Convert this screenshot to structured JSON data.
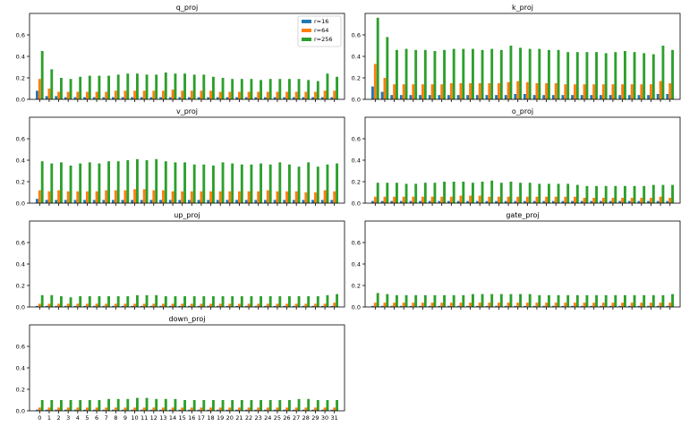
{
  "chart_data": {
    "type": "bar",
    "series_names": [
      "r=16",
      "r=64",
      "r=256"
    ],
    "colors": [
      "#1f77b4",
      "#ff7f0e",
      "#2ca02c"
    ],
    "x": [
      0,
      1,
      2,
      3,
      4,
      5,
      6,
      7,
      8,
      9,
      10,
      11,
      12,
      13,
      14,
      15,
      16,
      17,
      18,
      19,
      20,
      21,
      22,
      23,
      24,
      25,
      26,
      27,
      28,
      29,
      30,
      31
    ],
    "ylim": [
      0,
      0.8
    ],
    "yticks": [
      "0.0",
      "0.2",
      "0.4",
      "0.6"
    ],
    "legend_location": "top-right of first panel",
    "panels": [
      {
        "title": "q_proj",
        "series": [
          {
            "name": "r=16",
            "values": [
              0.08,
              0.03,
              0.03,
              0.02,
              0.02,
              0.02,
              0.02,
              0.02,
              0.02,
              0.02,
              0.02,
              0.02,
              0.02,
              0.02,
              0.02,
              0.02,
              0.02,
              0.02,
              0.02,
              0.02,
              0.02,
              0.02,
              0.02,
              0.02,
              0.02,
              0.02,
              0.02,
              0.02,
              0.02,
              0.02,
              0.02,
              0.02
            ]
          },
          {
            "name": "r=64",
            "values": [
              0.19,
              0.1,
              0.07,
              0.07,
              0.07,
              0.07,
              0.07,
              0.07,
              0.08,
              0.08,
              0.08,
              0.08,
              0.08,
              0.08,
              0.09,
              0.08,
              0.08,
              0.08,
              0.08,
              0.07,
              0.07,
              0.07,
              0.07,
              0.07,
              0.07,
              0.07,
              0.07,
              0.07,
              0.07,
              0.07,
              0.08,
              0.08
            ]
          },
          {
            "name": "r=256",
            "values": [
              0.45,
              0.28,
              0.2,
              0.19,
              0.21,
              0.22,
              0.22,
              0.22,
              0.23,
              0.24,
              0.24,
              0.23,
              0.23,
              0.25,
              0.24,
              0.24,
              0.23,
              0.23,
              0.21,
              0.2,
              0.19,
              0.19,
              0.19,
              0.18,
              0.19,
              0.19,
              0.19,
              0.19,
              0.18,
              0.17,
              0.24,
              0.21
            ]
          }
        ]
      },
      {
        "title": "k_proj",
        "series": [
          {
            "name": "r=16",
            "values": [
              0.12,
              0.07,
              0.04,
              0.04,
              0.04,
              0.04,
              0.04,
              0.04,
              0.04,
              0.04,
              0.04,
              0.04,
              0.04,
              0.04,
              0.04,
              0.05,
              0.05,
              0.04,
              0.04,
              0.04,
              0.04,
              0.04,
              0.04,
              0.04,
              0.04,
              0.04,
              0.04,
              0.04,
              0.04,
              0.04,
              0.05,
              0.05
            ]
          },
          {
            "name": "r=64",
            "values": [
              0.33,
              0.2,
              0.14,
              0.14,
              0.14,
              0.14,
              0.14,
              0.14,
              0.15,
              0.15,
              0.15,
              0.15,
              0.15,
              0.15,
              0.16,
              0.17,
              0.16,
              0.15,
              0.15,
              0.15,
              0.14,
              0.14,
              0.14,
              0.14,
              0.14,
              0.14,
              0.14,
              0.14,
              0.14,
              0.14,
              0.17,
              0.15
            ]
          },
          {
            "name": "r=256",
            "values": [
              0.76,
              0.58,
              0.46,
              0.47,
              0.46,
              0.46,
              0.45,
              0.46,
              0.47,
              0.47,
              0.47,
              0.46,
              0.47,
              0.46,
              0.5,
              0.48,
              0.47,
              0.47,
              0.46,
              0.46,
              0.44,
              0.44,
              0.44,
              0.44,
              0.43,
              0.44,
              0.45,
              0.44,
              0.43,
              0.42,
              0.5,
              0.46
            ]
          }
        ]
      },
      {
        "title": "v_proj",
        "series": [
          {
            "name": "r=16",
            "values": [
              0.04,
              0.03,
              0.03,
              0.03,
              0.03,
              0.03,
              0.03,
              0.03,
              0.03,
              0.03,
              0.03,
              0.03,
              0.03,
              0.03,
              0.03,
              0.03,
              0.03,
              0.03,
              0.03,
              0.03,
              0.03,
              0.03,
              0.03,
              0.03,
              0.03,
              0.03,
              0.03,
              0.03,
              0.03,
              0.03,
              0.03,
              0.03
            ]
          },
          {
            "name": "r=64",
            "values": [
              0.12,
              0.11,
              0.12,
              0.11,
              0.11,
              0.11,
              0.11,
              0.12,
              0.12,
              0.12,
              0.13,
              0.13,
              0.12,
              0.12,
              0.11,
              0.11,
              0.11,
              0.11,
              0.11,
              0.11,
              0.11,
              0.11,
              0.11,
              0.11,
              0.12,
              0.11,
              0.11,
              0.11,
              0.1,
              0.1,
              0.12,
              0.11
            ]
          },
          {
            "name": "r=256",
            "values": [
              0.39,
              0.37,
              0.38,
              0.35,
              0.37,
              0.38,
              0.37,
              0.39,
              0.39,
              0.4,
              0.41,
              0.4,
              0.41,
              0.39,
              0.38,
              0.38,
              0.36,
              0.36,
              0.35,
              0.38,
              0.37,
              0.36,
              0.36,
              0.37,
              0.36,
              0.38,
              0.36,
              0.34,
              0.38,
              0.34,
              0.36,
              0.37
            ]
          }
        ]
      },
      {
        "title": "o_proj",
        "series": [
          {
            "name": "r=16",
            "values": [
              0.02,
              0.02,
              0.02,
              0.02,
              0.02,
              0.02,
              0.02,
              0.02,
              0.02,
              0.02,
              0.02,
              0.02,
              0.02,
              0.02,
              0.02,
              0.02,
              0.02,
              0.02,
              0.02,
              0.02,
              0.02,
              0.02,
              0.02,
              0.02,
              0.02,
              0.02,
              0.02,
              0.02,
              0.02,
              0.02,
              0.02,
              0.02
            ]
          },
          {
            "name": "r=64",
            "values": [
              0.06,
              0.06,
              0.06,
              0.06,
              0.06,
              0.06,
              0.06,
              0.06,
              0.06,
              0.07,
              0.07,
              0.07,
              0.06,
              0.06,
              0.06,
              0.06,
              0.06,
              0.06,
              0.06,
              0.06,
              0.06,
              0.06,
              0.05,
              0.05,
              0.05,
              0.05,
              0.05,
              0.05,
              0.05,
              0.05,
              0.06,
              0.05
            ]
          },
          {
            "name": "r=256",
            "values": [
              0.19,
              0.19,
              0.19,
              0.18,
              0.18,
              0.19,
              0.19,
              0.2,
              0.2,
              0.2,
              0.19,
              0.2,
              0.21,
              0.19,
              0.2,
              0.19,
              0.19,
              0.18,
              0.18,
              0.18,
              0.18,
              0.17,
              0.16,
              0.16,
              0.16,
              0.16,
              0.16,
              0.16,
              0.16,
              0.17,
              0.17,
              0.17
            ]
          }
        ]
      },
      {
        "title": "up_proj",
        "series": [
          {
            "name": "r=16",
            "values": [
              0.01,
              0.01,
              0.01,
              0.01,
              0.01,
              0.01,
              0.01,
              0.01,
              0.01,
              0.01,
              0.01,
              0.01,
              0.01,
              0.01,
              0.01,
              0.01,
              0.01,
              0.01,
              0.01,
              0.01,
              0.01,
              0.01,
              0.01,
              0.01,
              0.01,
              0.01,
              0.01,
              0.01,
              0.01,
              0.01,
              0.01,
              0.01
            ]
          },
          {
            "name": "r=64",
            "values": [
              0.03,
              0.03,
              0.03,
              0.03,
              0.03,
              0.03,
              0.03,
              0.03,
              0.03,
              0.03,
              0.03,
              0.03,
              0.03,
              0.03,
              0.03,
              0.03,
              0.03,
              0.03,
              0.03,
              0.03,
              0.03,
              0.03,
              0.03,
              0.03,
              0.03,
              0.03,
              0.03,
              0.03,
              0.03,
              0.03,
              0.03,
              0.04
            ]
          },
          {
            "name": "r=256",
            "values": [
              0.11,
              0.11,
              0.1,
              0.09,
              0.1,
              0.1,
              0.1,
              0.1,
              0.1,
              0.1,
              0.11,
              0.11,
              0.11,
              0.1,
              0.1,
              0.1,
              0.1,
              0.1,
              0.1,
              0.1,
              0.1,
              0.1,
              0.1,
              0.1,
              0.1,
              0.1,
              0.1,
              0.1,
              0.1,
              0.1,
              0.11,
              0.12
            ]
          }
        ]
      },
      {
        "title": "gate_proj",
        "series": [
          {
            "name": "r=16",
            "values": [
              0.01,
              0.01,
              0.01,
              0.01,
              0.01,
              0.01,
              0.01,
              0.01,
              0.01,
              0.01,
              0.01,
              0.01,
              0.01,
              0.01,
              0.01,
              0.01,
              0.01,
              0.01,
              0.01,
              0.01,
              0.01,
              0.01,
              0.01,
              0.01,
              0.01,
              0.01,
              0.01,
              0.01,
              0.01,
              0.01,
              0.01,
              0.01
            ]
          },
          {
            "name": "r=64",
            "values": [
              0.04,
              0.04,
              0.04,
              0.04,
              0.04,
              0.04,
              0.04,
              0.04,
              0.04,
              0.04,
              0.04,
              0.04,
              0.04,
              0.04,
              0.04,
              0.04,
              0.04,
              0.04,
              0.04,
              0.04,
              0.04,
              0.04,
              0.04,
              0.04,
              0.04,
              0.04,
              0.04,
              0.04,
              0.04,
              0.04,
              0.04,
              0.04
            ]
          },
          {
            "name": "r=256",
            "values": [
              0.13,
              0.12,
              0.11,
              0.11,
              0.11,
              0.11,
              0.11,
              0.11,
              0.11,
              0.11,
              0.12,
              0.12,
              0.12,
              0.12,
              0.12,
              0.12,
              0.12,
              0.11,
              0.11,
              0.11,
              0.11,
              0.11,
              0.11,
              0.11,
              0.11,
              0.11,
              0.11,
              0.11,
              0.11,
              0.11,
              0.11,
              0.12
            ]
          }
        ]
      },
      {
        "title": "down_proj",
        "series": [
          {
            "name": "r=16",
            "values": [
              0.01,
              0.01,
              0.01,
              0.01,
              0.01,
              0.01,
              0.01,
              0.01,
              0.01,
              0.01,
              0.01,
              0.01,
              0.01,
              0.01,
              0.01,
              0.01,
              0.01,
              0.01,
              0.01,
              0.01,
              0.01,
              0.01,
              0.01,
              0.01,
              0.01,
              0.01,
              0.01,
              0.01,
              0.01,
              0.01,
              0.01,
              0.01
            ]
          },
          {
            "name": "r=64",
            "values": [
              0.03,
              0.03,
              0.03,
              0.03,
              0.03,
              0.03,
              0.03,
              0.03,
              0.03,
              0.03,
              0.03,
              0.03,
              0.03,
              0.03,
              0.03,
              0.03,
              0.03,
              0.03,
              0.03,
              0.03,
              0.03,
              0.03,
              0.03,
              0.03,
              0.03,
              0.03,
              0.03,
              0.03,
              0.03,
              0.03,
              0.03,
              0.03
            ]
          },
          {
            "name": "r=256",
            "values": [
              0.1,
              0.1,
              0.1,
              0.1,
              0.1,
              0.1,
              0.1,
              0.11,
              0.11,
              0.11,
              0.12,
              0.12,
              0.11,
              0.11,
              0.11,
              0.1,
              0.1,
              0.1,
              0.1,
              0.1,
              0.1,
              0.1,
              0.1,
              0.1,
              0.1,
              0.1,
              0.1,
              0.11,
              0.11,
              0.1,
              0.1,
              0.1
            ]
          }
        ]
      }
    ]
  }
}
